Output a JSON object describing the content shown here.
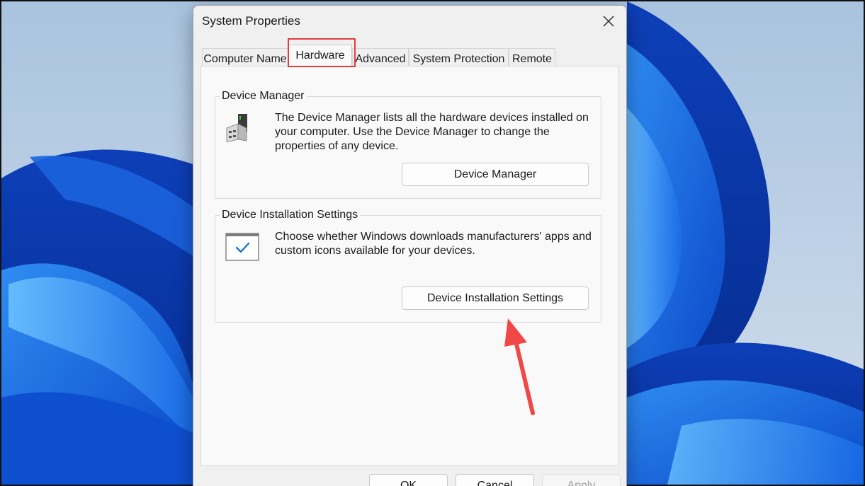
{
  "dialog": {
    "title": "System Properties"
  },
  "tabs": [
    {
      "label": "Computer Name"
    },
    {
      "label": "Hardware",
      "active": true
    },
    {
      "label": "Advanced"
    },
    {
      "label": "System Protection"
    },
    {
      "label": "Remote"
    }
  ],
  "device_manager": {
    "group_label": "Device Manager",
    "description": "The Device Manager lists all the hardware devices installed on your computer. Use the Device Manager to change the properties of any device.",
    "button_label": "Device Manager",
    "icon": "device-manager-icon"
  },
  "device_installation": {
    "group_label": "Device Installation Settings",
    "description": "Choose whether Windows downloads manufacturers' apps and custom icons available for your devices.",
    "button_label": "Device Installation Settings",
    "icon": "checkbox-window-icon"
  },
  "footer": {
    "ok_label": "OK",
    "cancel_label": "Cancel",
    "apply_label": "Apply"
  },
  "colors": {
    "highlight": "#e23c3c",
    "arrow": "#f04747",
    "check_accent": "#1a73c9"
  }
}
